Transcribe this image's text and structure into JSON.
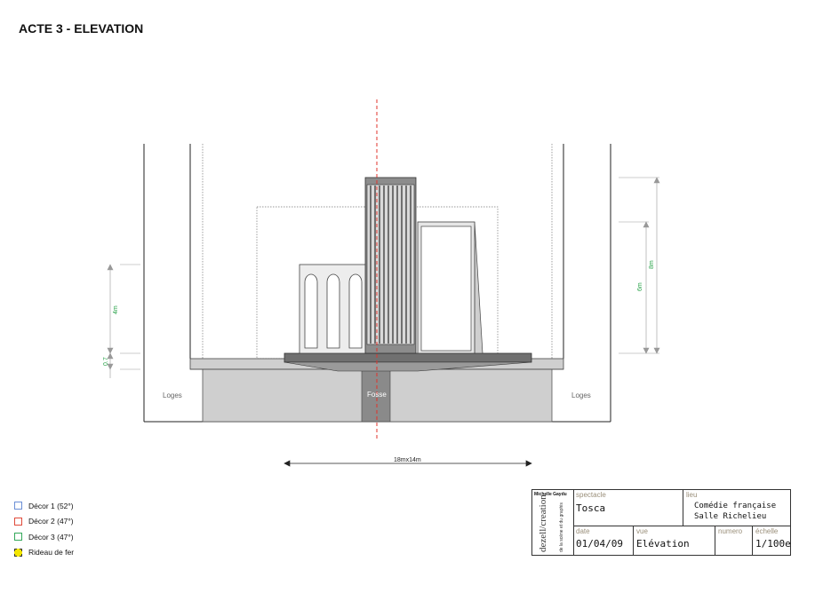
{
  "title": "ACTE 3 - ELEVATION",
  "labels": {
    "loges_left": "Loges",
    "loges_right": "Loges",
    "fosse": "Fosse",
    "dim_4m": "4m",
    "dim_07": "0.7",
    "dim_6m": "6m",
    "dim_8m": "8m",
    "dim_width": "18mx14m"
  },
  "legend": [
    {
      "label": "Décor 1 (52°)",
      "color": "#6b8fd6"
    },
    {
      "label": "Décor 2 (47°)",
      "color": "#e04a3a"
    },
    {
      "label": "Décor 3 (47°)",
      "color": "#33a85a"
    },
    {
      "label": "Rideau de fer",
      "color": "#e8d300"
    }
  ],
  "cartouche": {
    "author": "Michelle Gaydu",
    "brand": "dezell/creation",
    "tagline": "de la scène et du graphis",
    "spectacle_label": "spectacle",
    "spectacle_value": "Tosca",
    "lieu_label": "lieu",
    "lieu_value_1": "Comédie française",
    "lieu_value_2": "Salle Richelieu",
    "date_label": "date",
    "date_value": "01/04/09",
    "vue_label": "vue",
    "vue_value": "Elévation",
    "numero_label": "numero",
    "numero_value": "",
    "echelle_label": "échelle",
    "echelle_value": "1/100e"
  },
  "colors": {
    "axis": "#e0332b",
    "dimension": "#2aa34a",
    "stage": "#cccccc",
    "platform": "#777777"
  }
}
